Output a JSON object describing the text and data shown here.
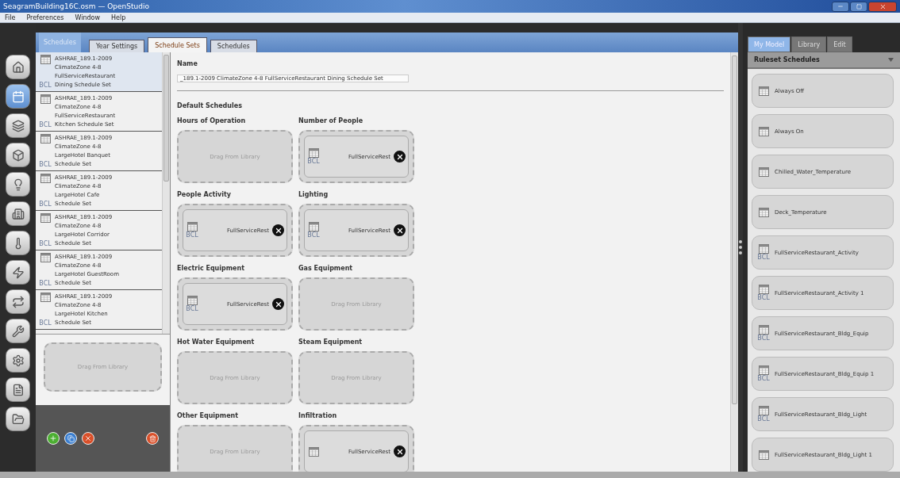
{
  "window": {
    "title": "SeagramBuilding16C.osm — OpenStudio"
  },
  "menu": [
    "File",
    "Preferences",
    "Window",
    "Help"
  ],
  "nav_items": [
    {
      "selected": false
    },
    {
      "selected": true
    },
    {
      "selected": false
    },
    {
      "selected": false
    },
    {
      "selected": false
    },
    {
      "selected": false
    },
    {
      "selected": false
    },
    {
      "selected": false
    },
    {
      "selected": false
    },
    {
      "selected": false
    },
    {
      "selected": false
    },
    {
      "selected": false
    },
    {
      "selected": false
    }
  ],
  "section_label": "Schedules",
  "tabs": [
    {
      "label": "Year Settings",
      "selected": false
    },
    {
      "label": "Schedule Sets",
      "selected": true
    },
    {
      "label": "Schedules",
      "selected": false
    }
  ],
  "schedule_sets": [
    {
      "lines": [
        "ASHRAE_189.1-2009",
        "ClimateZone 4-8",
        "FullServiceRestaurant",
        "Dining Schedule Set"
      ],
      "bcl": "BCL",
      "selected": true
    },
    {
      "lines": [
        "ASHRAE_189.1-2009",
        "ClimateZone 4-8",
        "FullServiceRestaurant",
        "Kitchen Schedule Set"
      ],
      "bcl": "BCL",
      "selected": false
    },
    {
      "lines": [
        "ASHRAE_189.1-2009",
        "ClimateZone 4-8",
        "LargeHotel Banquet",
        "Schedule Set"
      ],
      "bcl": "BCL",
      "selected": false
    },
    {
      "lines": [
        "ASHRAE_189.1-2009",
        "ClimateZone 4-8",
        "LargeHotel Cafe",
        "Schedule Set"
      ],
      "bcl": "BCL",
      "selected": false
    },
    {
      "lines": [
        "ASHRAE_189.1-2009",
        "ClimateZone 4-8",
        "LargeHotel Corridor",
        "Schedule Set"
      ],
      "bcl": "BCL",
      "selected": false
    },
    {
      "lines": [
        "ASHRAE_189.1-2009",
        "ClimateZone 4-8",
        "LargeHotel GuestRoom",
        "Schedule Set"
      ],
      "bcl": "BCL",
      "selected": false
    },
    {
      "lines": [
        "ASHRAE_189.1-2009",
        "ClimateZone 4-8",
        "LargeHotel Kitchen",
        "Schedule Set"
      ],
      "bcl": "BCL",
      "selected": false
    }
  ],
  "left_drop": "Drag From Library",
  "detail": {
    "name_label": "Name",
    "name_value": "_189.1-2009 ClimateZone 4-8 FullServiceRestaurant Dining Schedule Set",
    "section": "Default Schedules",
    "slots": [
      {
        "label": "Hours of Operation",
        "kind": "empty",
        "text": "Drag From Library"
      },
      {
        "label": "Number of People",
        "kind": "filled",
        "text": "FullServiceRest",
        "bcl": "BCL"
      },
      {
        "label": "People Activity",
        "kind": "filled",
        "text": "FullServiceRest",
        "bcl": "BCL"
      },
      {
        "label": "Lighting",
        "kind": "filled",
        "text": "FullServiceRest",
        "bcl": "BCL"
      },
      {
        "label": "Electric Equipment",
        "kind": "filled",
        "text": "FullServiceRest",
        "bcl": "BCL"
      },
      {
        "label": "Gas Equipment",
        "kind": "empty",
        "text": "Drag From Library"
      },
      {
        "label": "Hot Water Equipment",
        "kind": "empty",
        "text": "Drag From Library"
      },
      {
        "label": "Steam Equipment",
        "kind": "empty",
        "text": "Drag From Library"
      },
      {
        "label": "Other Equipment",
        "kind": "empty",
        "text": "Drag From Library"
      },
      {
        "label": "Infiltration",
        "kind": "filled",
        "text": "FullServiceRest"
      }
    ]
  },
  "right_tabs": [
    {
      "label": "My Model",
      "selected": true
    },
    {
      "label": "Library",
      "selected": false
    },
    {
      "label": "Edit",
      "selected": false
    }
  ],
  "right_header": "Ruleset Schedules",
  "right_items": [
    {
      "name": "Always Off"
    },
    {
      "name": "Always On"
    },
    {
      "name": "Chilled_Water_Temperature"
    },
    {
      "name": "Deck_Temperature"
    },
    {
      "name": "FullServiceRestaurant_Activity",
      "bcl": "BCL"
    },
    {
      "name": "FullServiceRestaurant_Activity 1",
      "bcl": "BCL"
    },
    {
      "name": "FullServiceRestaurant_Bldg_Equip",
      "bcl": "BCL"
    },
    {
      "name": "FullServiceRestaurant_Bldg_Equip 1",
      "bcl": "BCL"
    },
    {
      "name": "FullServiceRestaurant_Bldg_Light",
      "bcl": "BCL"
    },
    {
      "name": "FullServiceRestaurant_Bldg_Light 1"
    }
  ]
}
